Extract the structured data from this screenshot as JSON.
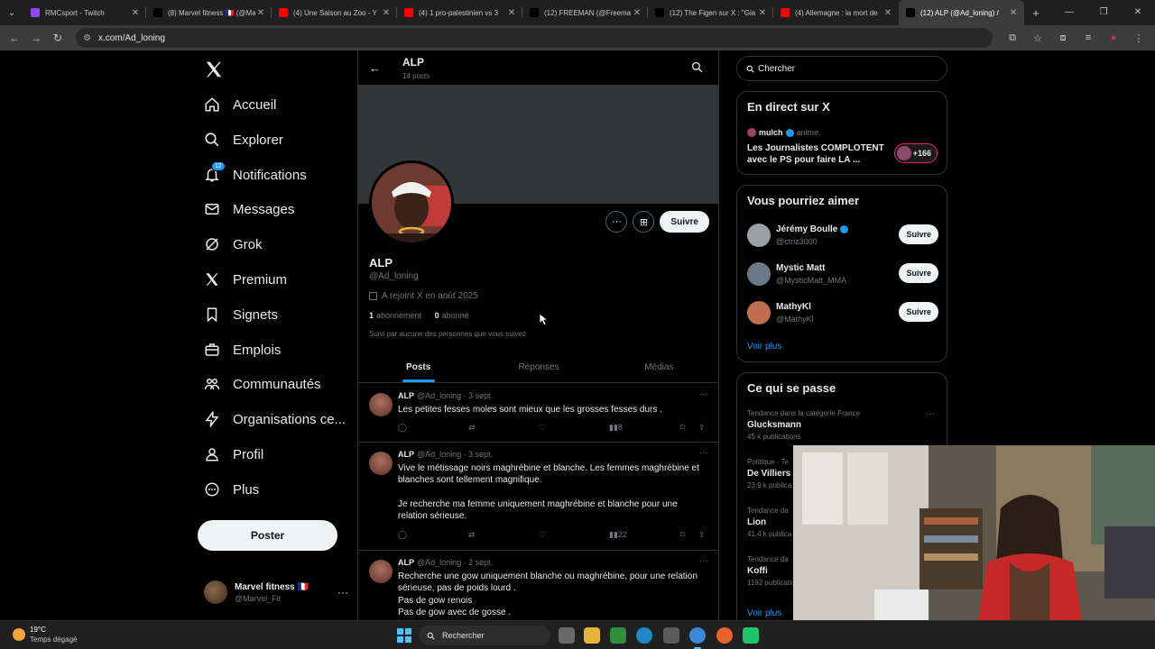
{
  "browser": {
    "tabs": [
      {
        "title": "RMCsport - Twitch",
        "fav_color": "#9146ff"
      },
      {
        "title": "(8) Marvel fitness 🇫🇷 (@Ma",
        "fav_color": "#000000"
      },
      {
        "title": "(4) Une Saison au Zoo - Y",
        "fav_color": "#ff0000"
      },
      {
        "title": "(4) 1 pro-palestinien vs 3",
        "fav_color": "#ff0000"
      },
      {
        "title": "(12) FREEMAN (@Freema",
        "fav_color": "#000000"
      },
      {
        "title": "(12) The Figen sur X : \"Gia",
        "fav_color": "#000000"
      },
      {
        "title": "(4) Allemagne : la mort de",
        "fav_color": "#ff0000"
      },
      {
        "title": "(12) ALP (@Ad_loning) /",
        "fav_color": "#000000"
      }
    ],
    "address": "x.com/Ad_loning"
  },
  "sidebar": {
    "items": [
      {
        "label": "Accueil",
        "icon": "home-icon"
      },
      {
        "label": "Explorer",
        "icon": "search-icon"
      },
      {
        "label": "Notifications",
        "icon": "bell-icon",
        "badge": "12"
      },
      {
        "label": "Messages",
        "icon": "mail-icon"
      },
      {
        "label": "Grok",
        "icon": "grok-icon"
      },
      {
        "label": "Premium",
        "icon": "x-logo-icon"
      },
      {
        "label": "Signets",
        "icon": "bookmark-icon"
      },
      {
        "label": "Emplois",
        "icon": "briefcase-icon"
      },
      {
        "label": "Communautés",
        "icon": "people-icon"
      },
      {
        "label": "Organisations ce...",
        "icon": "bolt-icon"
      },
      {
        "label": "Profil",
        "icon": "person-icon"
      },
      {
        "label": "Plus",
        "icon": "more-circle-icon"
      }
    ],
    "post_label": "Poster",
    "account": {
      "name": "Marvel fitness 🇫🇷",
      "handle": "@Marvel_Fit"
    }
  },
  "profile": {
    "header_name": "ALP",
    "post_count": "14 posts",
    "name": "ALP",
    "handle": "@Ad_loning",
    "joined": "A rejoint X en août 2025",
    "following_count": "1",
    "following_label": "abonnement",
    "followers_count": "0",
    "followers_label": "abonné",
    "note": "Suivi par aucune des personnes que vous suivez",
    "follow_label": "Suivre",
    "tabs": [
      "Posts",
      "Réponses",
      "Médias"
    ]
  },
  "tweets": [
    {
      "name": "ALP",
      "meta": "@Ad_loning · 3 sept.",
      "lines": [
        "Les petites fesses moles sont mieux que les grosses fesses durs ."
      ],
      "views": "8"
    },
    {
      "name": "ALP",
      "meta": "@Ad_loning · 3 sept.",
      "lines": [
        "Vive le métissage noirs maghrébine et blanche. Les femmes maghrébine et",
        "blanches sont tellement magnifique.",
        "",
        "Je recherche ma femme uniquement maghrébine et blanche  pour une",
        "relation sérieuse."
      ],
      "views": "22"
    },
    {
      "name": "ALP",
      "meta": "@Ad_loning · 2 sept.",
      "lines": [
        "Recherche une gow uniquement blanche ou maghrébine, pour une relation",
        "sérieuse, pas de poids lourd .",
        "Pas de gow renois",
        "Pas de gow avec de gosse ."
      ],
      "views": ""
    }
  ],
  "right": {
    "search_placeholder": "Chercher",
    "live": {
      "title": "En direct sur X",
      "host": "mulch",
      "host_suffix": "anime.",
      "stream_title": "Les Journalistes COMPLOTENT avec le PS pour faire LA ...",
      "count": "+166"
    },
    "suggestions": {
      "title": "Vous pourriez aimer",
      "items": [
        {
          "name": "Jérémy Boulle",
          "handle": "@ctriz3000",
          "verified": true,
          "avatar_color": "#9aa0a6"
        },
        {
          "name": "Mystic Matt",
          "handle": "@MysticMatt_MMA",
          "verified": false,
          "avatar_color": "#6b7a8a"
        },
        {
          "name": "MathyKl",
          "handle": "@MathyKl",
          "verified": false,
          "avatar_color": "#c07050"
        }
      ],
      "follow_label": "Suivre",
      "more": "Voir plus"
    },
    "trends": {
      "title": "Ce qui se passe",
      "items": [
        {
          "context": "Tendance dans la catégorie France",
          "name": "Glucksmann",
          "count": "45 k publications"
        },
        {
          "context": "Politique · Te",
          "name": "De Villiers",
          "count": "23,9 k publica"
        },
        {
          "context": "Tendance da",
          "name": "Lion",
          "count": "41,4 k publica"
        },
        {
          "context": "Tendance da",
          "name": "Koffi",
          "count": "1192 publicatio"
        }
      ],
      "more": "Voir plus"
    }
  },
  "taskbar": {
    "temp": "19°C",
    "weather": "Temps dégagé",
    "search": "Rechercher"
  }
}
